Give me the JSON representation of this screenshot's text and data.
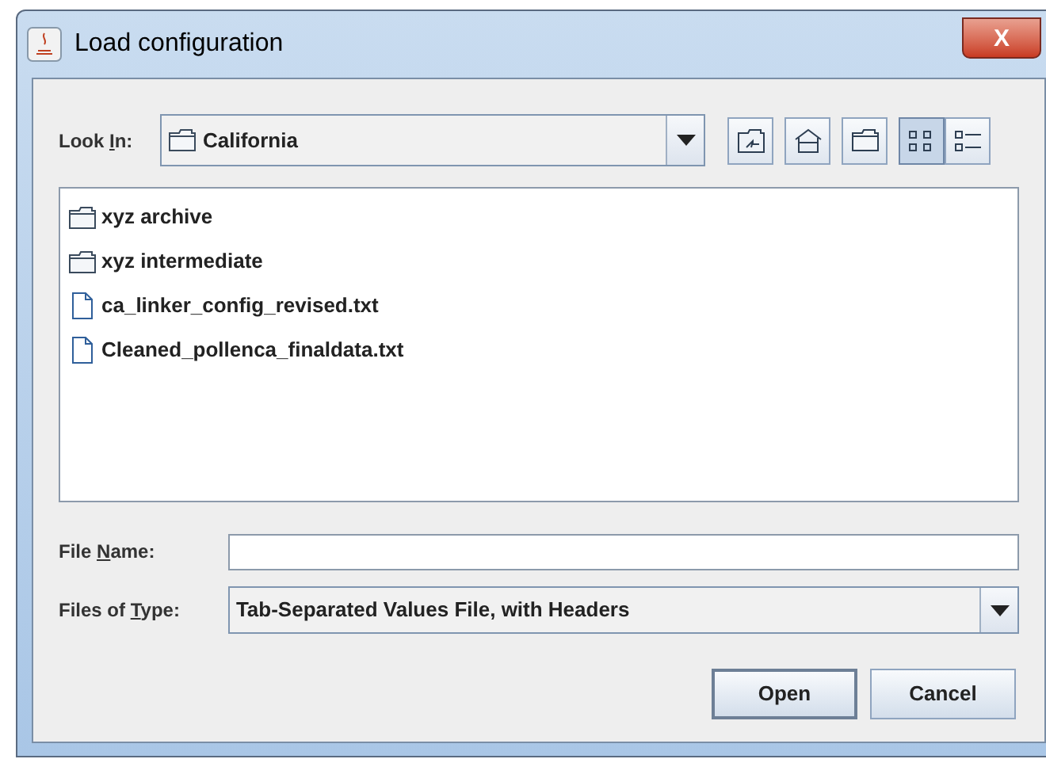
{
  "window": {
    "title": "Load configuration",
    "close": "X"
  },
  "look_in": {
    "label_start": "Look ",
    "mnemonic": "I",
    "label_end": "n:",
    "value": "California"
  },
  "toolbar": [
    {
      "kind": "up",
      "selected": false
    },
    {
      "kind": "home",
      "selected": false
    },
    {
      "kind": "new-folder",
      "selected": false
    },
    {
      "kind": "list",
      "selected": true
    },
    {
      "kind": "details",
      "selected": false
    }
  ],
  "files": [
    {
      "name": "xyz archive",
      "kind": "folder"
    },
    {
      "name": "xyz intermediate",
      "kind": "folder"
    },
    {
      "name": "ca_linker_config_revised.txt",
      "kind": "file"
    },
    {
      "name": "Cleaned_pollenca_finaldata.txt",
      "kind": "file"
    }
  ],
  "file_name": {
    "label_start": "File ",
    "mnemonic": "N",
    "label_end": "ame:"
  },
  "files_of_type": {
    "label_start": "Files of ",
    "mnemonic": "T",
    "label_end": "ype:",
    "value": "Tab-Separated Values File, with Headers"
  },
  "buttons": [
    {
      "label": "Open",
      "default": true
    },
    {
      "label": "Cancel",
      "default": false
    }
  ]
}
